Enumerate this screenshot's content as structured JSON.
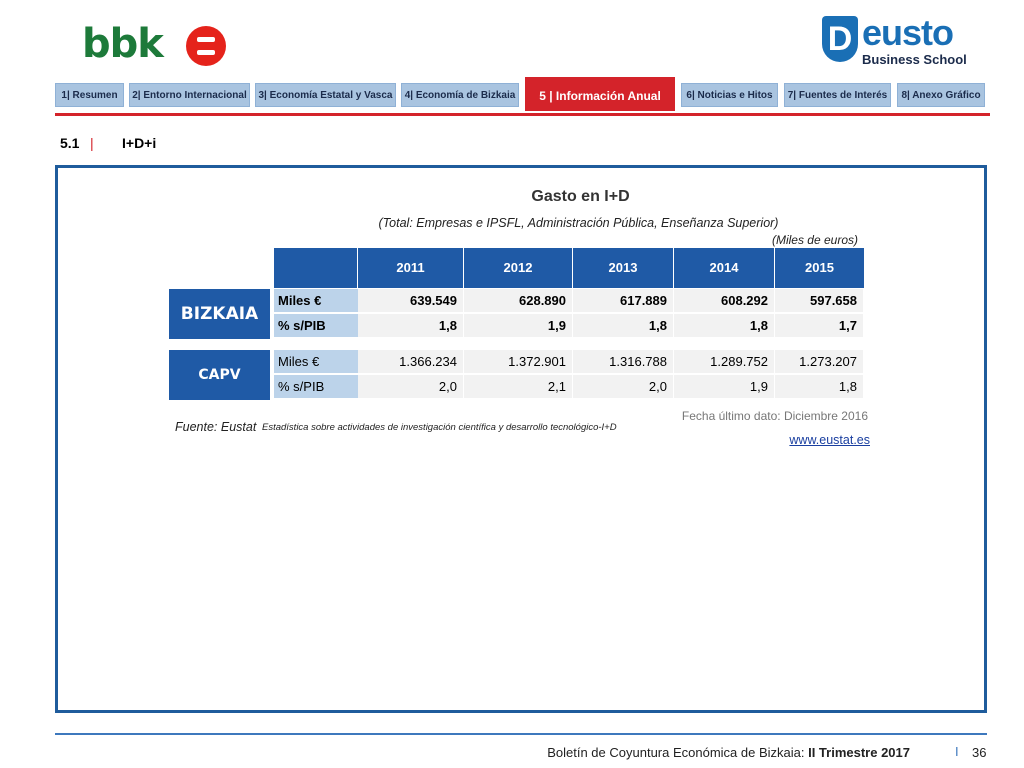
{
  "header": {
    "left_logo": "bbk",
    "right_logo": {
      "name": "Deusto",
      "subtitle": "Business School",
      "shield_letter": "D",
      "word": "eusto"
    }
  },
  "nav": {
    "tabs": [
      {
        "label": "1| Resumen",
        "active": false
      },
      {
        "label": "2| Entorno Internacional",
        "active": false
      },
      {
        "label": "3| Economía Estatal y Vasca",
        "active": false
      },
      {
        "label": "4| Economía de Bizkaia",
        "active": false
      },
      {
        "label": "5 | Información Anual",
        "active": true
      },
      {
        "label": "6| Noticias e Hitos",
        "active": false
      },
      {
        "label": "7| Fuentes de Interés",
        "active": false
      },
      {
        "label": "8| Anexo Gráfico",
        "active": false
      }
    ]
  },
  "section": {
    "number": "5.1",
    "separator": "|",
    "title": "I+D+i"
  },
  "content": {
    "title": "Gasto en I+D",
    "subtitle": "(Total: Empresas e IPSFL, Administración Pública, Enseñanza Superior)",
    "unit": "(Miles de euros)",
    "years": [
      "2011",
      "2012",
      "2013",
      "2014",
      "2015"
    ],
    "regions": [
      {
        "name": "BIZKAIA",
        "rows": [
          {
            "label": "Miles €",
            "values": [
              "639.549",
              "628.890",
              "617.889",
              "608.292",
              "597.658"
            ]
          },
          {
            "label": "% s/PIB",
            "values": [
              "1,8",
              "1,9",
              "1,8",
              "1,8",
              "1,7"
            ]
          }
        ]
      },
      {
        "name": "CAPV",
        "rows": [
          {
            "label": "Miles €",
            "values": [
              "1.366.234",
              "1.372.901",
              "1.316.788",
              "1.289.752",
              "1.273.207"
            ]
          },
          {
            "label": "% s/PIB",
            "values": [
              "2,0",
              "2,1",
              "2,0",
              "1,9",
              "1,8"
            ]
          }
        ]
      }
    ],
    "source_label": "Fuente: Eustat",
    "source_text": "Estadística sobre actividades de investigación científica y desarrollo tecnológico-I+D",
    "last_date": "Fecha último dato: Diciembre 2016",
    "link": "www.eustat.es"
  },
  "footer": {
    "text_normal": "Boletín de Coyuntura Económica de Bizkaia: ",
    "text_bold": "II Trimestre 2017",
    "separator": "I",
    "page": "36"
  },
  "colors": {
    "accent_red": "#d4232a",
    "table_blue": "#1f5aa6",
    "tab_blue": "#a9c4e0",
    "bbk_green": "#1d7a3a"
  }
}
